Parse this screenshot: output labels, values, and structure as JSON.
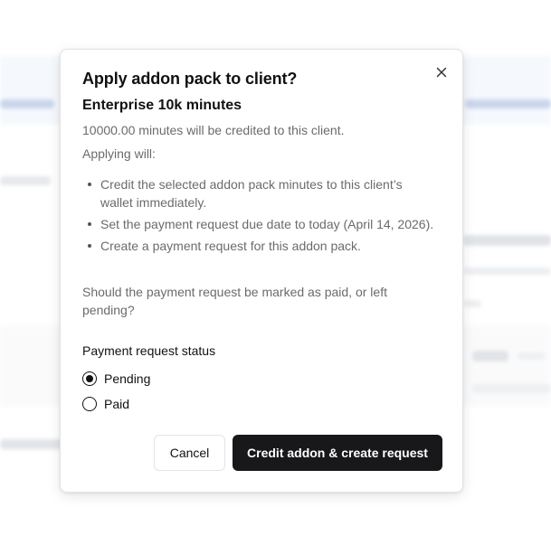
{
  "dialog": {
    "title": "Apply addon pack to client?",
    "pack_name": "Enterprise 10k minutes",
    "credit_note": "10000.00 minutes will be credited to this client.",
    "applying_label": "Applying will:",
    "effects": [
      "Credit the selected addon pack minutes to this client’s wallet immediately.",
      "Set the payment request due date to today (April 14, 2026).",
      "Create a payment request for this addon pack."
    ],
    "question": "Should the payment request be marked as paid, or left pending?",
    "status_label": "Payment request status",
    "options": [
      {
        "label": "Pending",
        "selected": true
      },
      {
        "label": "Paid",
        "selected": false
      }
    ],
    "cancel_label": "Cancel",
    "confirm_label": "Credit addon & create request",
    "close_icon": "close-icon"
  },
  "colors": {
    "primary_button": "#18181b",
    "muted_text": "#6b6b6b",
    "background_band": "#eef3fb"
  }
}
